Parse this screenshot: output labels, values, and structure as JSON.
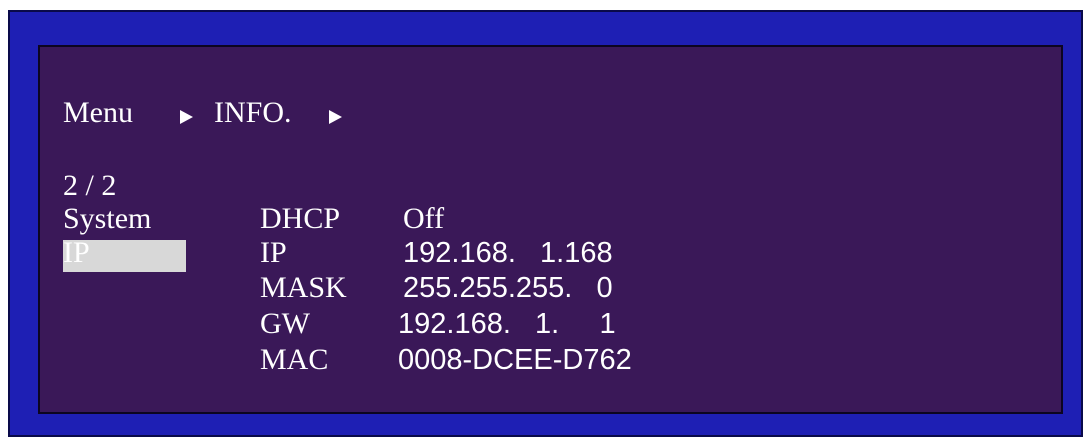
{
  "breadcrumb": {
    "root": "Menu",
    "section": "INFO.",
    "arrow_icon": "triangle-right-icon"
  },
  "page_indicator": "2 / 2",
  "left_menu": {
    "items": [
      {
        "label": "System",
        "selected": false
      },
      {
        "label": "IP",
        "selected": true
      }
    ]
  },
  "info": {
    "rows": [
      {
        "label": "DHCP",
        "value": "Off"
      },
      {
        "label": "IP",
        "value": "192.168.   1.168"
      },
      {
        "label": "MASK",
        "value": "255.255.255.   0"
      },
      {
        "label": "GW",
        "value": "192.168.   1.     1"
      },
      {
        "label": "MAC",
        "value": "0008-DCEE-D762"
      }
    ]
  },
  "colors": {
    "outer_frame": "#1e1fb4",
    "screen_bg": "#3a1858",
    "text": "#ffffff",
    "selection_bg": "#d8d8d8"
  }
}
